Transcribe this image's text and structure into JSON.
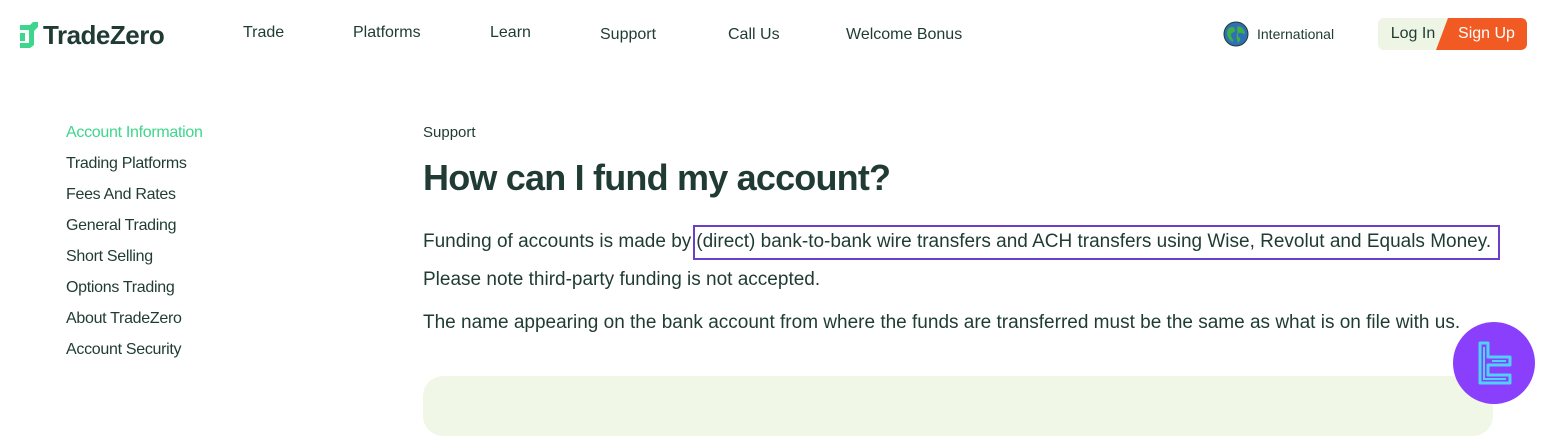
{
  "brand": {
    "name": "TradeZero",
    "colors": {
      "primary_text": "#1f3b33",
      "accent_green": "#3dd68c",
      "signup_orange": "#f15a22",
      "highlight_border": "#6a3fc9",
      "badge_purple": "#8a3ffc"
    }
  },
  "nav": {
    "items": [
      {
        "label": "Trade"
      },
      {
        "label": "Platforms"
      },
      {
        "label": "Learn"
      },
      {
        "label": "Support"
      },
      {
        "label": "Call Us"
      },
      {
        "label": "Welcome Bonus"
      }
    ],
    "region_label": "International",
    "region_icon": "globe-icon",
    "login_label": "Log In",
    "signup_label": "Sign Up"
  },
  "sidebar": {
    "items": [
      {
        "label": "Account Information",
        "active": true
      },
      {
        "label": "Trading Platforms",
        "active": false
      },
      {
        "label": "Fees And Rates",
        "active": false
      },
      {
        "label": "General Trading",
        "active": false
      },
      {
        "label": "Short Selling",
        "active": false
      },
      {
        "label": "Options Trading",
        "active": false
      },
      {
        "label": "About TradeZero",
        "active": false
      },
      {
        "label": "Account Security",
        "active": false
      }
    ]
  },
  "main": {
    "eyebrow": "Support",
    "title": "How can I fund my account?",
    "p1_prefix": "Funding of accounts is made by",
    "p1_highlight": "(direct) bank-to-bank wire transfers and ACH transfers using Wise, Revolut and Equals Money.",
    "p2": "Please note third-party funding is not accepted.",
    "p3": "The name appearing on the bank account from where the funds are transferred must be the same as what is on file with us."
  },
  "badge": {
    "icon": "tradingfinder-logo-icon"
  }
}
